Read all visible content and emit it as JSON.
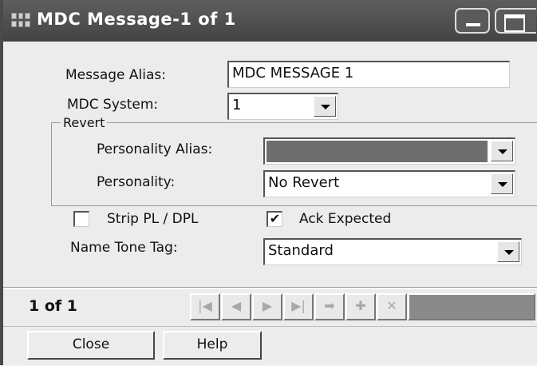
{
  "window": {
    "title": "MDC Message-1 of 1"
  },
  "form": {
    "message_alias_label": "Message Alias:",
    "message_alias_value": "MDC MESSAGE 1",
    "mdc_system_label": "MDC System:",
    "mdc_system_value": "1",
    "revert_group_label": "Revert",
    "personality_alias_label": "Personality Alias:",
    "personality_alias_value": "",
    "personality_label": "Personality:",
    "personality_value": "No Revert",
    "strip_pl_label": "Strip PL / DPL",
    "strip_pl_checked": false,
    "ack_expected_label": "Ack Expected",
    "ack_expected_checked": true,
    "ack_check_mark": "✔",
    "name_tone_tag_label": "Name Tone Tag:",
    "name_tone_tag_value": "Standard"
  },
  "navigation": {
    "record_count": "1 of 1",
    "buttons": [
      {
        "name": "first-record-icon",
        "glyph": "|◀"
      },
      {
        "name": "previous-record-icon",
        "glyph": "◀"
      },
      {
        "name": "next-record-icon",
        "glyph": "▶"
      },
      {
        "name": "last-record-icon",
        "glyph": "▶|"
      },
      {
        "name": "goto-arrow-icon",
        "glyph": "➡"
      },
      {
        "name": "add-record-icon",
        "glyph": "✚"
      },
      {
        "name": "delete-record-icon",
        "glyph": "✕"
      }
    ]
  },
  "buttons": {
    "close": "Close",
    "help": "Help"
  },
  "colors": {
    "title_bar": "#4f4f4f",
    "alias_fill": "#6e6e6e"
  }
}
